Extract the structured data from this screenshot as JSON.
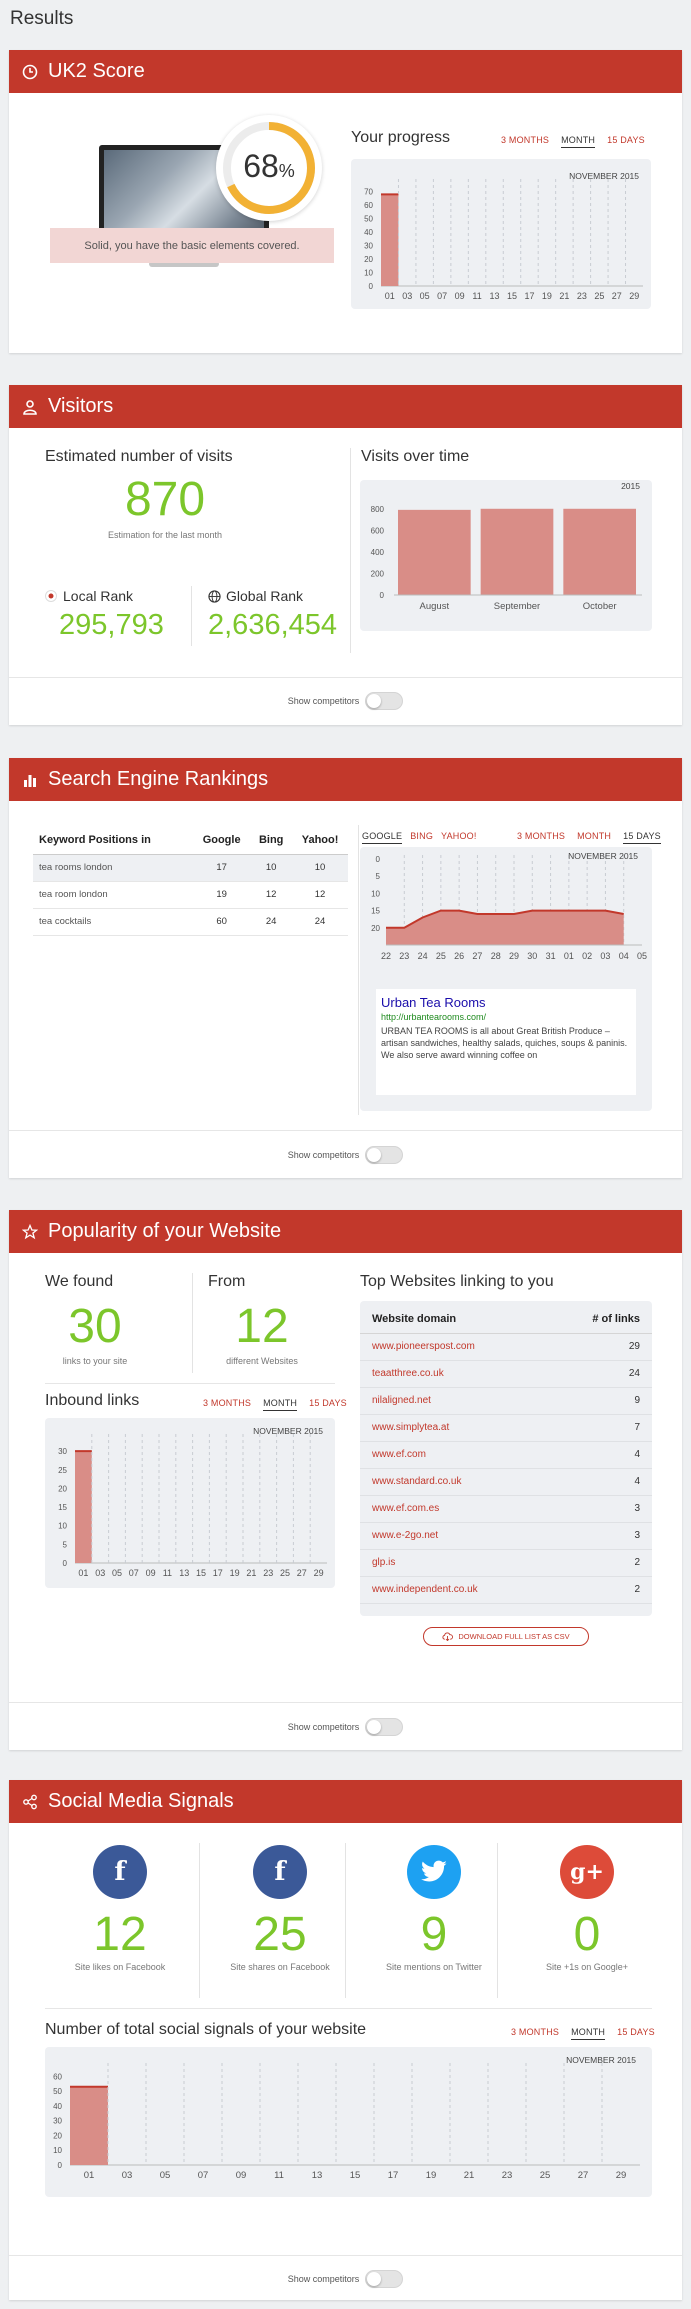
{
  "page": {
    "title": "Results"
  },
  "ranges": {
    "three_months": "3 MONTHS",
    "month": "MONTH",
    "fifteen_days": "15 DAYS"
  },
  "toggle": {
    "label": "Show competitors"
  },
  "score": {
    "header": "UK2 Score",
    "percent": "68",
    "percent_sign": "%",
    "percent_value": 68,
    "message": "Solid, you have the basic elements covered.",
    "progress_title": "Your progress",
    "chart_month": "NOVEMBER 2015"
  },
  "visitors": {
    "header": "Visitors",
    "estimated_title": "Estimated number of visits",
    "estimated_value": "870",
    "estimated_caption": "Estimation for the last month",
    "local_rank_label": "Local Rank",
    "local_rank_value": "295,793",
    "global_rank_label": "Global Rank",
    "global_rank_value": "2,636,454",
    "over_time_title": "Visits over time",
    "chart_year": "2015"
  },
  "ser": {
    "header": "Search Engine Rankings",
    "columns": [
      "Keyword Positions in",
      "Google",
      "Bing",
      "Yahoo!"
    ],
    "rows": [
      {
        "keyword": "tea rooms london",
        "google": "17",
        "bing": "10",
        "yahoo": "10"
      },
      {
        "keyword": "tea room london",
        "google": "19",
        "bing": "12",
        "yahoo": "12"
      },
      {
        "keyword": "tea cocktails",
        "google": "60",
        "bing": "24",
        "yahoo": "24"
      }
    ],
    "engines": [
      "GOOGLE",
      "BING",
      "YAHOO!"
    ],
    "chart_month": "NOVEMBER 2015",
    "result": {
      "title": "Urban Tea Rooms",
      "url": "http://urbantearooms.com/",
      "snippet": "URBAN TEA ROOMS is all about Great British Produce – artisan sandwiches, healthy salads, quiches, soups & paninis. We also serve award winning coffee on"
    }
  },
  "popularity": {
    "header": "Popularity of your Website",
    "found_label": "We found",
    "found_value": "30",
    "found_caption": "links to your site",
    "from_label": "From",
    "from_value": "12",
    "from_caption": "different Websites",
    "inbound_title": "Inbound links",
    "chart_month": "NOVEMBER 2015",
    "top_title": "Top Websites linking to you",
    "table_headers": [
      "Website domain",
      "# of links"
    ],
    "sites": [
      {
        "domain": "www.pioneerspost.com",
        "links": "29"
      },
      {
        "domain": "teaatthree.co.uk",
        "links": "24"
      },
      {
        "domain": "nilaligned.net",
        "links": "9"
      },
      {
        "domain": "www.simplytea.at",
        "links": "7"
      },
      {
        "domain": "www.ef.com",
        "links": "4"
      },
      {
        "domain": "www.standard.co.uk",
        "links": "4"
      },
      {
        "domain": "www.ef.com.es",
        "links": "3"
      },
      {
        "domain": "www.e-2go.net",
        "links": "3"
      },
      {
        "domain": "glp.is",
        "links": "2"
      },
      {
        "domain": "www.independent.co.uk",
        "links": "2"
      }
    ],
    "download_label": "DOWNLOAD FULL LIST AS CSV"
  },
  "social": {
    "header": "Social Media Signals",
    "items": [
      {
        "icon": "facebook-icon",
        "glyph": "f",
        "value": "12",
        "caption": "Site likes on Facebook",
        "color": "#3b5998"
      },
      {
        "icon": "facebook-icon",
        "glyph": "f",
        "value": "25",
        "caption": "Site shares on Facebook",
        "color": "#3b5998"
      },
      {
        "icon": "twitter-icon",
        "glyph": "t",
        "value": "9",
        "caption": "Site mentions on Twitter",
        "color": "#1da1f2"
      },
      {
        "icon": "google-plus-icon",
        "glyph": "g+",
        "value": "0",
        "caption": "Site +1s on Google+",
        "color": "#dd4b39"
      }
    ],
    "total_title": "Number of total social signals of your website",
    "chart_month": "NOVEMBER 2015"
  },
  "colors": {
    "accent": "#c2382b",
    "green": "#7cc62b",
    "bar": "#d98d87",
    "gauge": "#f2b134"
  },
  "chart_data": [
    {
      "name": "score-progress",
      "type": "bar",
      "x": [
        "01",
        "03",
        "05",
        "07",
        "09",
        "11",
        "13",
        "15",
        "17",
        "19",
        "21",
        "23",
        "25",
        "27",
        "29"
      ],
      "values": [
        68,
        null,
        null,
        null,
        null,
        null,
        null,
        null,
        null,
        null,
        null,
        null,
        null,
        null,
        null
      ],
      "yticks": [
        0,
        10,
        20,
        30,
        40,
        50,
        60,
        70
      ],
      "ylim": [
        0,
        75
      ],
      "title": "NOVEMBER 2015"
    },
    {
      "name": "visits-over-time",
      "type": "bar",
      "categories": [
        "August",
        "September",
        "October"
      ],
      "values": [
        790,
        800,
        800
      ],
      "yticks": [
        0,
        200,
        400,
        600,
        800
      ],
      "ylim": [
        0,
        900
      ],
      "title": "2015"
    },
    {
      "name": "search-rankings",
      "type": "area",
      "x": [
        "22",
        "23",
        "24",
        "25",
        "26",
        "27",
        "28",
        "29",
        "30",
        "31",
        "01",
        "02",
        "03",
        "04",
        "05"
      ],
      "values": [
        20,
        20,
        17,
        15,
        15,
        16,
        16,
        16,
        15,
        15,
        15,
        15,
        15,
        16
      ],
      "yticks": [
        5,
        10,
        15,
        20
      ],
      "ylim": [
        0,
        25
      ],
      "inverted": true,
      "title": "NOVEMBER 2015"
    },
    {
      "name": "inbound-links",
      "type": "bar",
      "x": [
        "01",
        "03",
        "05",
        "07",
        "09",
        "11",
        "13",
        "15",
        "17",
        "19",
        "21",
        "23",
        "25",
        "27",
        "29"
      ],
      "values": [
        30,
        null,
        null,
        null,
        null,
        null,
        null,
        null,
        null,
        null,
        null,
        null,
        null,
        null,
        null
      ],
      "yticks": [
        0,
        5,
        10,
        15,
        20,
        25,
        30
      ],
      "ylim": [
        0,
        33
      ],
      "title": "NOVEMBER 2015"
    },
    {
      "name": "social-signals",
      "type": "bar",
      "x": [
        "01",
        "03",
        "05",
        "07",
        "09",
        "11",
        "13",
        "15",
        "17",
        "19",
        "21",
        "23",
        "25",
        "27",
        "29"
      ],
      "values": [
        53,
        null,
        null,
        null,
        null,
        null,
        null,
        null,
        null,
        null,
        null,
        null,
        null,
        null,
        null
      ],
      "yticks": [
        0,
        10,
        20,
        30,
        40,
        50,
        60
      ],
      "ylim": [
        0,
        65
      ],
      "title": "NOVEMBER 2015"
    }
  ]
}
